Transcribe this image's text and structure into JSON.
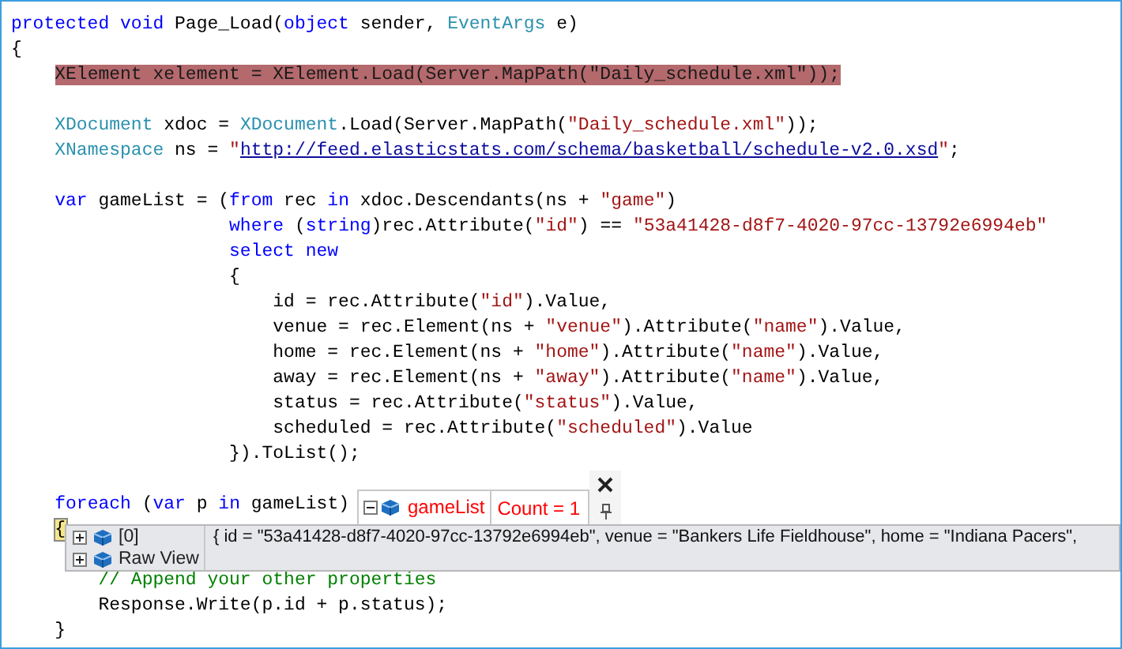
{
  "code_lines": [
    {
      "kind": "code",
      "tokens": [
        {
          "kind": "kw",
          "text": "protected void"
        },
        {
          "kind": "plain",
          "text": " Page_Load("
        },
        {
          "kind": "kw",
          "text": "object"
        },
        {
          "kind": "plain",
          "text": " sender, "
        },
        {
          "kind": "type",
          "text": "EventArgs"
        },
        {
          "kind": "plain",
          "text": " e)"
        }
      ]
    },
    {
      "kind": "code",
      "tokens": [
        {
          "kind": "plain",
          "text": "{"
        }
      ]
    },
    {
      "kind": "code",
      "highlighted": true,
      "tokens": [
        {
          "kind": "plain",
          "text": "    XElement xelement = XElement.Load(Server.MapPath(\"Daily_schedule.xml\"));"
        }
      ]
    },
    {
      "kind": "blank"
    },
    {
      "kind": "code",
      "tokens": [
        {
          "kind": "type",
          "text": "    XDocument"
        },
        {
          "kind": "plain",
          "text": " xdoc = "
        },
        {
          "kind": "type",
          "text": "XDocument"
        },
        {
          "kind": "plain",
          "text": ".Load(Server.MapPath("
        },
        {
          "kind": "str",
          "text": "\"Daily_schedule.xml\""
        },
        {
          "kind": "plain",
          "text": "));"
        }
      ]
    },
    {
      "kind": "code",
      "tokens": [
        {
          "kind": "type",
          "text": "    XNamespace"
        },
        {
          "kind": "plain",
          "text": " ns = "
        },
        {
          "kind": "str",
          "text": "\""
        },
        {
          "kind": "link",
          "text": "http://feed.elasticstats.com/schema/basketball/schedule-v2.0.xsd"
        },
        {
          "kind": "str",
          "text": "\""
        },
        {
          "kind": "plain",
          "text": ";"
        }
      ]
    },
    {
      "kind": "blank"
    },
    {
      "kind": "code",
      "tokens": [
        {
          "kind": "kw",
          "text": "    var"
        },
        {
          "kind": "plain",
          "text": " gameList = ("
        },
        {
          "kind": "kw",
          "text": "from"
        },
        {
          "kind": "plain",
          "text": " rec "
        },
        {
          "kind": "kw",
          "text": "in"
        },
        {
          "kind": "plain",
          "text": " xdoc.Descendants(ns + "
        },
        {
          "kind": "str",
          "text": "\"game\""
        },
        {
          "kind": "plain",
          "text": ")"
        }
      ]
    },
    {
      "kind": "code",
      "tokens": [
        {
          "kind": "kw",
          "text": "                    where"
        },
        {
          "kind": "plain",
          "text": " ("
        },
        {
          "kind": "kw",
          "text": "string"
        },
        {
          "kind": "plain",
          "text": ")rec.Attribute("
        },
        {
          "kind": "str",
          "text": "\"id\""
        },
        {
          "kind": "plain",
          "text": ") == "
        },
        {
          "kind": "str",
          "text": "\"53a41428-d8f7-4020-97cc-13792e6994eb\""
        }
      ]
    },
    {
      "kind": "code",
      "tokens": [
        {
          "kind": "kw",
          "text": "                    select new"
        }
      ]
    },
    {
      "kind": "code",
      "tokens": [
        {
          "kind": "plain",
          "text": "                    {"
        }
      ]
    },
    {
      "kind": "code",
      "tokens": [
        {
          "kind": "plain",
          "text": "                        id = rec.Attribute("
        },
        {
          "kind": "str",
          "text": "\"id\""
        },
        {
          "kind": "plain",
          "text": ").Value,"
        }
      ]
    },
    {
      "kind": "code",
      "tokens": [
        {
          "kind": "plain",
          "text": "                        venue = rec.Element(ns + "
        },
        {
          "kind": "str",
          "text": "\"venue\""
        },
        {
          "kind": "plain",
          "text": ").Attribute("
        },
        {
          "kind": "str",
          "text": "\"name\""
        },
        {
          "kind": "plain",
          "text": ").Value,"
        }
      ]
    },
    {
      "kind": "code",
      "tokens": [
        {
          "kind": "plain",
          "text": "                        home = rec.Element(ns + "
        },
        {
          "kind": "str",
          "text": "\"home\""
        },
        {
          "kind": "plain",
          "text": ").Attribute("
        },
        {
          "kind": "str",
          "text": "\"name\""
        },
        {
          "kind": "plain",
          "text": ").Value,"
        }
      ]
    },
    {
      "kind": "code",
      "tokens": [
        {
          "kind": "plain",
          "text": "                        away = rec.Element(ns + "
        },
        {
          "kind": "str",
          "text": "\"away\""
        },
        {
          "kind": "plain",
          "text": ").Attribute("
        },
        {
          "kind": "str",
          "text": "\"name\""
        },
        {
          "kind": "plain",
          "text": ").Value,"
        }
      ]
    },
    {
      "kind": "code",
      "tokens": [
        {
          "kind": "plain",
          "text": "                        status = rec.Attribute("
        },
        {
          "kind": "str",
          "text": "\"status\""
        },
        {
          "kind": "plain",
          "text": ").Value,"
        }
      ]
    },
    {
      "kind": "code",
      "tokens": [
        {
          "kind": "plain",
          "text": "                        scheduled = rec.Attribute("
        },
        {
          "kind": "str",
          "text": "\"scheduled\""
        },
        {
          "kind": "plain",
          "text": ").Value"
        }
      ]
    },
    {
      "kind": "code",
      "tokens": [
        {
          "kind": "plain",
          "text": "                    }).ToList();"
        }
      ]
    },
    {
      "kind": "blank"
    },
    {
      "kind": "code",
      "tokens": [
        {
          "kind": "kw",
          "text": "    foreach"
        },
        {
          "kind": "plain",
          "text": " ("
        },
        {
          "kind": "kw",
          "text": "var"
        },
        {
          "kind": "plain",
          "text": " p "
        },
        {
          "kind": "kw",
          "text": "in"
        },
        {
          "kind": "plain",
          "text": " gameList)"
        }
      ]
    },
    {
      "kind": "code",
      "tokens": [
        {
          "kind": "brace",
          "text": "    {"
        }
      ]
    },
    {
      "kind": "blank"
    },
    {
      "kind": "code",
      "tokens": [
        {
          "kind": "comment",
          "text": "        // Append your other properties"
        }
      ]
    },
    {
      "kind": "code",
      "tokens": [
        {
          "kind": "plain",
          "text": "        Response.Write(p.id + p.status);"
        }
      ]
    },
    {
      "kind": "code",
      "tokens": [
        {
          "kind": "plain",
          "text": "    }"
        }
      ]
    }
  ],
  "datatip": {
    "name": "gameList",
    "value": "Count = 1",
    "expanded": true,
    "children": [
      {
        "name": "[0]",
        "value": "{ id = \"53a41428-d8f7-4020-97cc-13792e6994eb\", venue = \"Bankers Life Fieldhouse\", home = \"Indiana Pacers\",",
        "expanded": false
      },
      {
        "name": "Raw View",
        "expanded": false
      }
    ]
  }
}
